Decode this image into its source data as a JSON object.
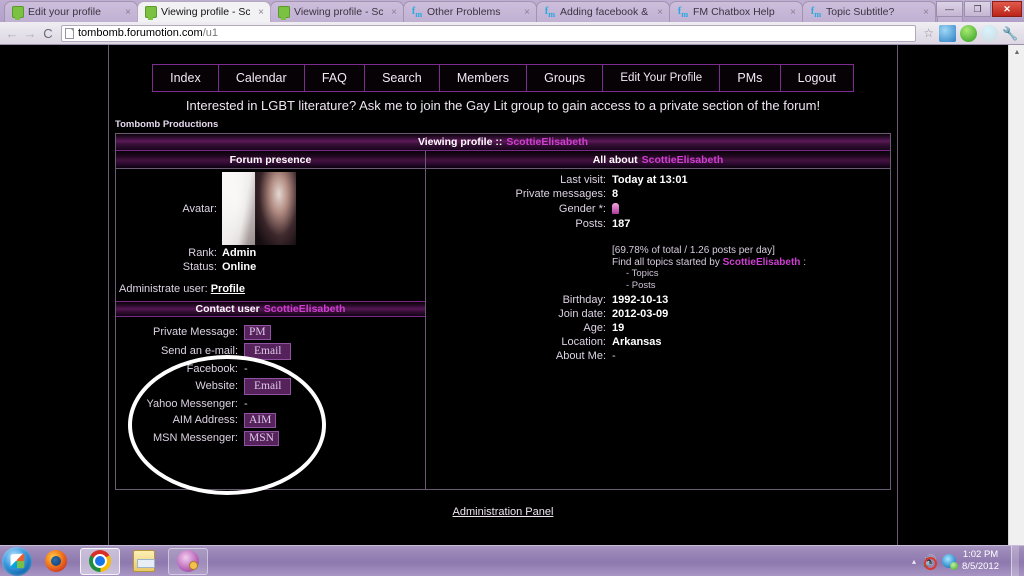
{
  "browser": {
    "tabs": [
      {
        "label": "Edit your profile",
        "favicon": "screen-icon",
        "active": false
      },
      {
        "label": "Viewing profile - Scotti",
        "favicon": "screen-icon",
        "active": true
      },
      {
        "label": "Viewing profile - Scotti",
        "favicon": "screen-icon",
        "active": false
      },
      {
        "label": "Other Problems",
        "favicon": "fm-icon",
        "active": false
      },
      {
        "label": "Adding facebook & tw",
        "favicon": "fm-icon",
        "active": false
      },
      {
        "label": "FM Chatbox Help",
        "favicon": "fm-icon",
        "active": false
      },
      {
        "label": "Topic Subtitle?",
        "favicon": "fm-icon",
        "active": false
      }
    ],
    "tab_close_glyph": "×",
    "window_controls": {
      "minimize": "—",
      "maximize": "❐",
      "close": "✕"
    },
    "nav": {
      "back": "←",
      "forward": "→",
      "reload": "C"
    },
    "url": {
      "host": "tombomb.forumotion.com",
      "path": "/u1"
    },
    "star_glyph": "☆",
    "extensions": [
      "skype-click-to-call-icon",
      "evernote-icon",
      "phone-icon",
      "wrench-menu-icon"
    ],
    "scrollbar_up_glyph": "▲"
  },
  "forum": {
    "nav_items": [
      "Index",
      "Calendar",
      "FAQ",
      "Search",
      "Members",
      "Groups",
      "Edit Your Profile",
      "PMs",
      "Logout"
    ],
    "announcement": "Interested in LGBT literature? Ask me to join the Gay Lit group to gain access to a private section of the forum!",
    "brand": "Tombomb Productions",
    "title_prefix": "Viewing profile ::",
    "username": "ScottieElisabeth",
    "col_left_header": "Forum presence",
    "col_right_header_prefix": "All about",
    "presence": {
      "avatar_label": "Avatar:",
      "rows": [
        {
          "label": "Rank:",
          "value": "Admin"
        },
        {
          "label": "Status:",
          "value": "Online"
        }
      ],
      "administrate_label": "Administrate user:",
      "administrate_link": "Profile"
    },
    "contact": {
      "header_prefix": "Contact user",
      "rows": [
        {
          "label": "Private Message:",
          "value": "PM",
          "type": "button"
        },
        {
          "label": "Send an e-mail:",
          "value": "Email",
          "type": "button-wide"
        },
        {
          "label": "Facebook:",
          "value": "-",
          "type": "text"
        },
        {
          "label": "Website:",
          "value": "Email",
          "type": "button-wide"
        },
        {
          "label": "Yahoo Messenger:",
          "value": "-",
          "type": "text"
        },
        {
          "label": "AIM Address:",
          "value": "AIM",
          "type": "button"
        },
        {
          "label": "MSN Messenger:",
          "value": "MSN",
          "type": "button"
        }
      ]
    },
    "about": {
      "top_rows": [
        {
          "label": "Last visit:",
          "value": "Today at 13:01"
        },
        {
          "label": "Private messages:",
          "value": "8"
        },
        {
          "label": "Gender *:",
          "value": "",
          "icon": "female-gender-icon"
        },
        {
          "label": "Posts:",
          "value": "187"
        }
      ],
      "stats": "[69.78% of total / 1.26 posts per day]",
      "find_prefix": "Find all topics started by",
      "find_suffix": ":",
      "find_links": [
        "- Topics",
        "- Posts"
      ],
      "bottom_rows": [
        {
          "label": "Birthday:",
          "value": "1992-10-13"
        },
        {
          "label": "Join date:",
          "value": "2012-03-09"
        },
        {
          "label": "Age:",
          "value": "19"
        },
        {
          "label": "Location:",
          "value": "Arkansas"
        },
        {
          "label": "About Me:",
          "value": "-"
        }
      ]
    },
    "admin_panel_link": "Administration Panel"
  },
  "taskbar": {
    "start_label": "Start",
    "buttons": [
      {
        "name": "firefox",
        "icon": "firefox-icon"
      },
      {
        "name": "chrome",
        "icon": "chrome-icon"
      },
      {
        "name": "explorer",
        "icon": "folder-icon"
      },
      {
        "name": "paint",
        "icon": "paint-icon"
      }
    ],
    "tray_arrow": "▴",
    "time": "1:02 PM",
    "date": "8/5/2012"
  },
  "colors": {
    "accent_purple": "#cf3fd1",
    "border_purple": "#7d2d8f",
    "page_background": "#000000",
    "chrome_frame": "#b9a7cc",
    "taskbar": "#9b88b8",
    "annotation": "#ffffff"
  }
}
